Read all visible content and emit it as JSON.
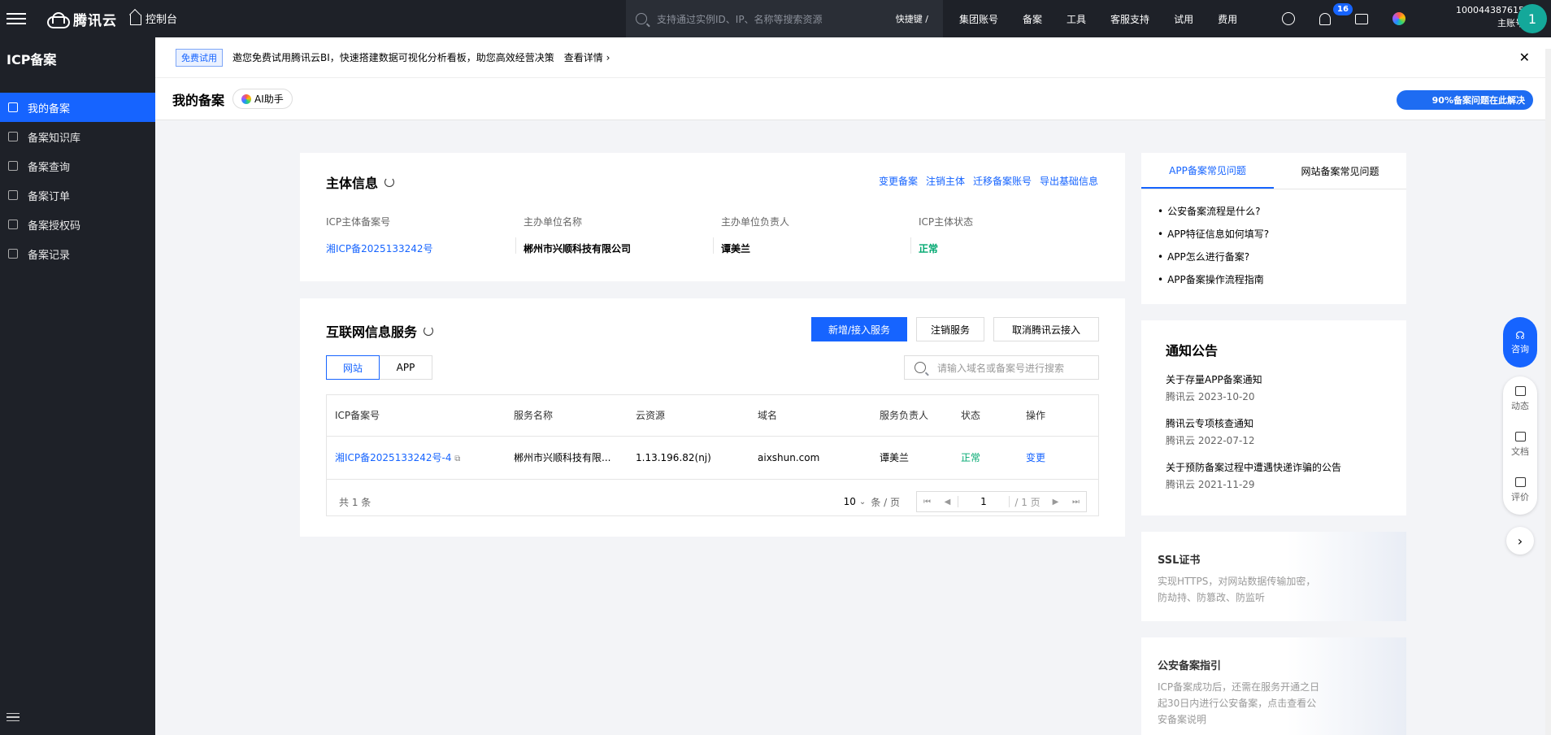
{
  "topbar": {
    "logo_text": "腾讯云",
    "console_label": "控制台",
    "search_placeholder": "支持通过实例ID、IP、名称等搜索资源",
    "search_shortcut": "快捷键 /",
    "nav": [
      "集团账号",
      "备案",
      "工具",
      "客服支持",
      "试用",
      "费用"
    ],
    "notification_count": "16",
    "account_id": "100044387615",
    "account_role": "主账号",
    "avatar_initial": "1"
  },
  "sidebar": {
    "title": "ICP备案",
    "items": [
      {
        "label": "我的备案",
        "icon": "bookmark-icon"
      },
      {
        "label": "备案知识库",
        "icon": "book-icon"
      },
      {
        "label": "备案查询",
        "icon": "search-doc-icon"
      },
      {
        "label": "备案订单",
        "icon": "order-icon"
      },
      {
        "label": "备案授权码",
        "icon": "key-icon"
      },
      {
        "label": "备案记录",
        "icon": "record-icon"
      }
    ]
  },
  "banner": {
    "tag": "免费试用",
    "message": "邀您免费试用腾讯云BI，快速搭建数据可视化分析看板，助您高效经营决策",
    "detail_link": "查看详情 ›"
  },
  "page": {
    "title": "我的备案",
    "ai_button": "AI助手",
    "help_pill": "90%备案问题在此解决"
  },
  "subject": {
    "title": "主体信息",
    "links": [
      "变更备案",
      "注销主体",
      "迁移备案账号",
      "导出基础信息"
    ],
    "fields": [
      {
        "label": "ICP主体备案号",
        "value": "湘ICP备2025133242号"
      },
      {
        "label": "主办单位名称",
        "value": "郴州市兴顺科技有限公司"
      },
      {
        "label": "主办单位负责人",
        "value": "谭美兰"
      },
      {
        "label": "ICP主体状态",
        "value": "正常"
      }
    ]
  },
  "services": {
    "title": "互联网信息服务",
    "buttons": [
      "新增/接入服务",
      "注销服务",
      "取消腾讯云接入"
    ],
    "tabs": [
      "网站",
      "APP"
    ],
    "search_placeholder": "请输入域名或备案号进行搜索",
    "columns": [
      "ICP备案号",
      "服务名称",
      "云资源",
      "域名",
      "服务负责人",
      "状态",
      "操作"
    ],
    "rows": [
      [
        "湘ICP备2025133242号-4",
        "郴州市兴顺科技有限...",
        "1.13.196.82(nj)",
        "aixshun.com",
        "谭美兰",
        "正常",
        "变更"
      ]
    ],
    "total": "共 1 条",
    "page_size": "10",
    "page_size_unit": "条 / 页",
    "page_current": "1",
    "page_total": "/ 1 页"
  },
  "faq": {
    "tabs": [
      "APP备案常见问题",
      "网站备案常见问题"
    ],
    "items": [
      "公安备案流程是什么?",
      "APP特征信息如何填写?",
      "APP怎么进行备案?",
      "APP备案操作流程指南"
    ]
  },
  "notices": {
    "title": "通知公告",
    "items": [
      {
        "title": "关于存量APP备案通知",
        "date": "腾讯云 2023-10-20"
      },
      {
        "title": "腾讯云专项核查通知",
        "date": "腾讯云 2022-07-12"
      },
      {
        "title": "关于预防备案过程中遭遇快递诈骗的公告",
        "date": "腾讯云 2021-11-29"
      }
    ]
  },
  "promos": [
    {
      "title": "SSL证书",
      "desc": "实现HTTPS，对网站数据传输加密，防劫持、防篡改、防监听"
    },
    {
      "title": "公安备案指引",
      "desc": "ICP备案成功后，还需在服务开通之日起30日内进行公安备案，点击查看公安备案说明"
    }
  ],
  "float": {
    "consult": "咨询",
    "panel": [
      "动态",
      "文档",
      "评价"
    ]
  },
  "colors": {
    "accent": "#1664ff",
    "ok": "#00a870",
    "dark": "#1e2128"
  }
}
